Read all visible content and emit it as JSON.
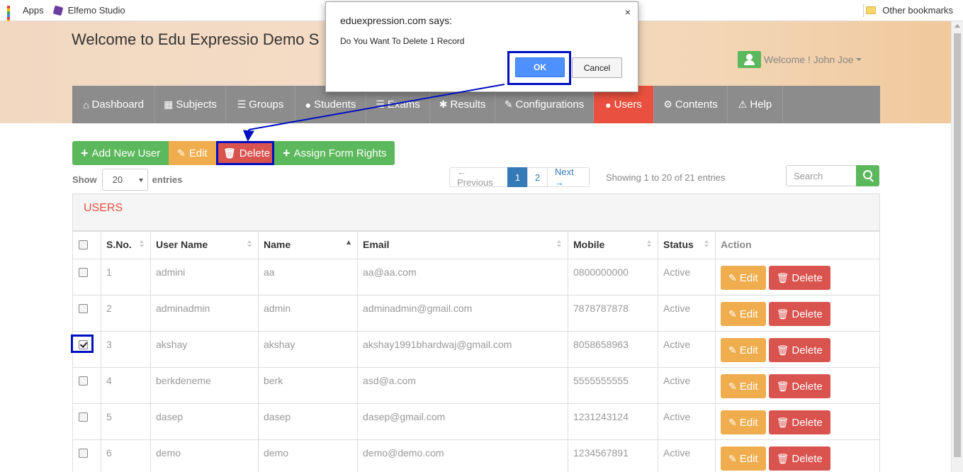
{
  "browser": {
    "bookmarks": [
      {
        "label": "Apps",
        "icon": "apps-grid-icon"
      },
      {
        "label": "Elfemo Studio",
        "icon": "elfemo-icon"
      }
    ],
    "other_bookmarks": "Other bookmarks"
  },
  "header": {
    "site_title": "Welcome to Edu Expressio Demo S",
    "welcome_user": "Welcome ! John Joe"
  },
  "nav": [
    {
      "label": "Dashboard",
      "icon": "home-icon",
      "glyph": "🏠"
    },
    {
      "label": "Subjects",
      "icon": "grid-icon",
      "glyph": "▦"
    },
    {
      "label": "Groups",
      "icon": "list-icon",
      "glyph": "☰"
    },
    {
      "label": "Students",
      "icon": "user-icon",
      "glyph": "👤"
    },
    {
      "label": "Exams",
      "icon": "document-icon",
      "glyph": "☰"
    },
    {
      "label": "Results",
      "icon": "asterisk-icon",
      "glyph": "✱"
    },
    {
      "label": "Configurations",
      "icon": "wrench-icon",
      "glyph": "🔧"
    },
    {
      "label": "Users",
      "icon": "user-icon",
      "glyph": "👤",
      "active": true
    },
    {
      "label": "Contents",
      "icon": "cog-icon",
      "glyph": "⚙"
    },
    {
      "label": "Help",
      "icon": "warning-icon",
      "glyph": "⚠"
    }
  ],
  "toolbar": {
    "add_label": "Add New User",
    "edit_label": "Edit",
    "delete_label": "Delete",
    "assign_label": "Assign Form Rights"
  },
  "length": {
    "show_label": "Show",
    "value": "20",
    "entries_label": "entries"
  },
  "pagination": {
    "previous": "← Previous",
    "pages": [
      "1",
      "2"
    ],
    "current": "1",
    "next": "Next →",
    "info": "Showing 1 to 20 of 21 entries"
  },
  "search": {
    "placeholder": "Search"
  },
  "panel": {
    "title": "USERS"
  },
  "table": {
    "columns": [
      "S.No.",
      "User Name",
      "Name",
      "Email",
      "Mobile",
      "Status",
      "Action"
    ],
    "rows": [
      {
        "sno": "1",
        "username": "admini",
        "name": "aa",
        "email": "aa@aa.com",
        "mobile": "0800000000",
        "status": "Active",
        "checked": false
      },
      {
        "sno": "2",
        "username": "adminadmin",
        "name": "admin",
        "email": "adminadmin@gmail.com",
        "mobile": "7878787878",
        "status": "Active",
        "checked": false
      },
      {
        "sno": "3",
        "username": "akshay",
        "name": "akshay",
        "email": "akshay1991bhardwaj@gmail.com",
        "mobile": "8058658963",
        "status": "Active",
        "checked": true
      },
      {
        "sno": "4",
        "username": "berkdeneme",
        "name": "berk",
        "email": "asd@a.com",
        "mobile": "5555555555",
        "status": "Active",
        "checked": false
      },
      {
        "sno": "5",
        "username": "dasep",
        "name": "dasep",
        "email": "dasep@gmail.com",
        "mobile": "1231243124",
        "status": "Active",
        "checked": false
      },
      {
        "sno": "6",
        "username": "demo",
        "name": "demo",
        "email": "demo@demo.com",
        "mobile": "1234567891",
        "status": "Active",
        "checked": false
      }
    ],
    "row_edit_label": "Edit",
    "row_delete_label": "Delete"
  },
  "dialog": {
    "title": "eduexpression.com says:",
    "message": "Do You Want To Delete 1 Record",
    "ok_label": "OK",
    "cancel_label": "Cancel",
    "close_glyph": "×"
  },
  "colors": {
    "nav_bg": "#8c8c8c",
    "active_tab": "#e9503f",
    "success": "#5cb85c",
    "warning": "#f0ad4e",
    "danger": "#d9534f",
    "primary": "#337ab7",
    "annotation": "#0010c0"
  }
}
